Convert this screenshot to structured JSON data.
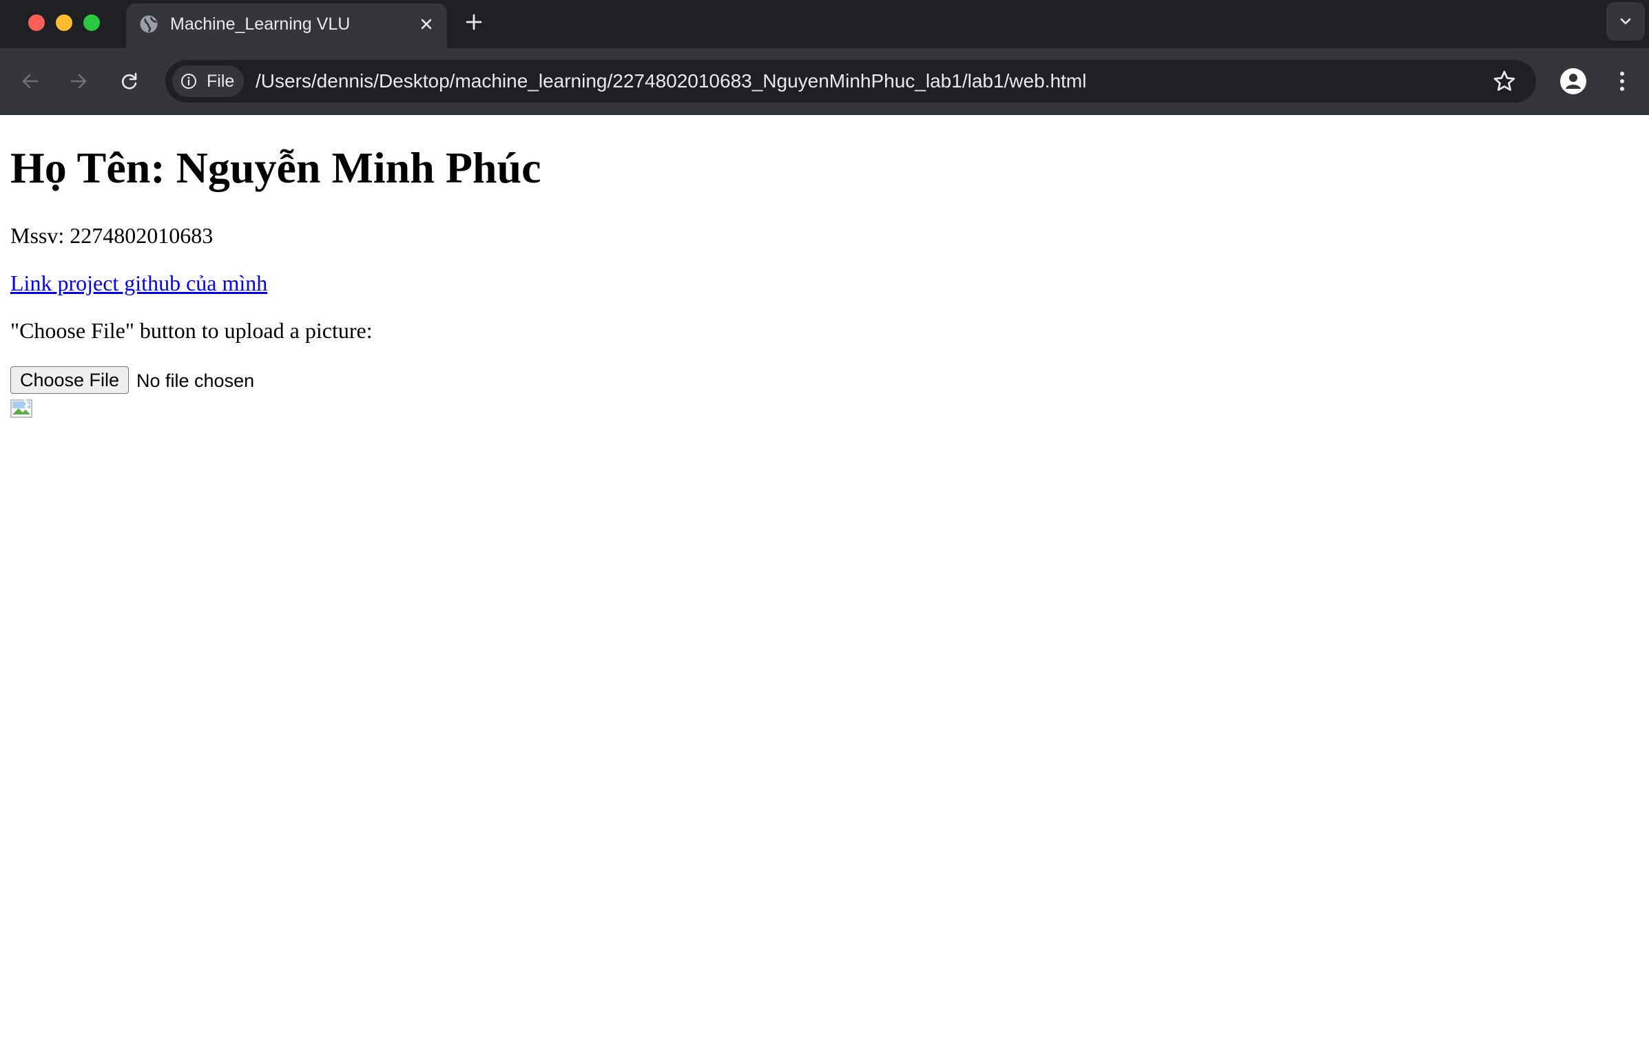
{
  "browser": {
    "tab": {
      "title": "Machine_Learning VLU"
    },
    "omnibox": {
      "chip_label": "File",
      "url": "/Users/dennis/Desktop/machine_learning/2274802010683_NguyenMinhPhuc_lab1/lab1/web.html"
    },
    "icons": {
      "favicon": "globe-icon",
      "close": "close-icon",
      "new_tab": "plus-icon",
      "tab_search": "chevron-down-icon",
      "back": "arrow-left-icon",
      "forward": "arrow-right-icon",
      "reload": "reload-icon",
      "site_info": "info-icon",
      "bookmark": "star-icon",
      "profile": "person-icon",
      "menu": "kebab-menu-icon"
    },
    "colors": {
      "tabstrip": "#1f2023",
      "toolbar": "#35363a",
      "close": "#fe5f57",
      "minimize": "#febc2e",
      "maximize": "#28c840"
    }
  },
  "page": {
    "heading": "Họ Tên: Nguyễn Minh Phúc",
    "mssv": "Mssv: 2274802010683",
    "link_text": "Link project github của mình",
    "instruction": "\"Choose File\" button to upload a picture:",
    "file_input": {
      "button_label": "Choose File",
      "status": "No file chosen"
    },
    "link_color": "#0000ee"
  }
}
